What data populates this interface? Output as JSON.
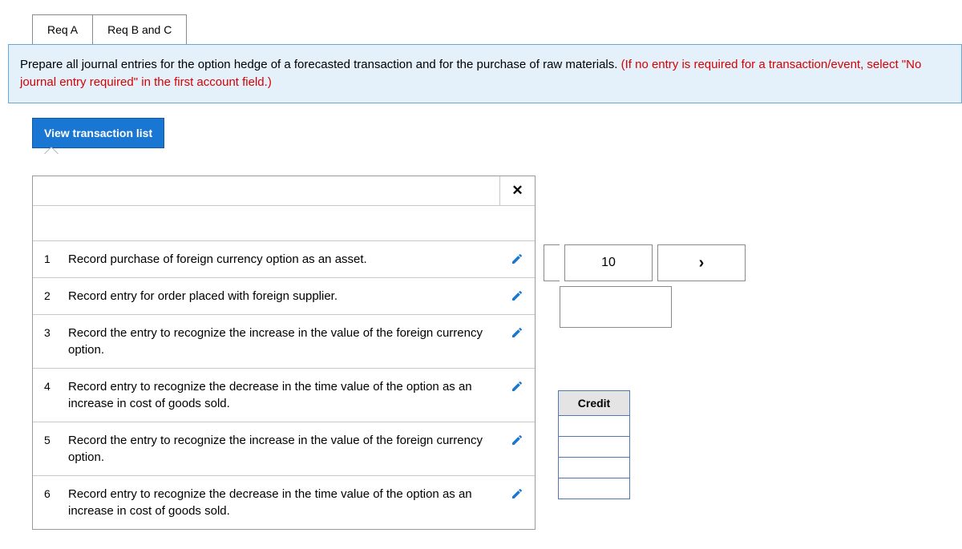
{
  "tabs": {
    "a": "Req A",
    "b": "Req B and C"
  },
  "instruction": {
    "main": "Prepare all journal entries for the option hedge of a forecasted transaction and for the purchase of raw materials. ",
    "red": "(If no entry is required for a transaction/event, select \"No journal entry required\" in the first account field.)"
  },
  "view_btn": "View transaction list",
  "close_label": "✕",
  "transactions": [
    {
      "n": "1",
      "text": "Record purchase of foreign currency option as an asset."
    },
    {
      "n": "2",
      "text": "Record entry for order placed with foreign supplier."
    },
    {
      "n": "3",
      "text": "Record the entry to recognize the increase in the value of the foreign currency option."
    },
    {
      "n": "4",
      "text": "Record entry to recognize the decrease in the time value of the option as an increase in cost of goods sold."
    },
    {
      "n": "5",
      "text": "Record the entry to recognize the increase in the value of the foreign currency option."
    },
    {
      "n": "6",
      "text": "Record entry to recognize the decrease in the time value of the option as an increase in cost of goods sold."
    }
  ],
  "pager": {
    "current": "10"
  },
  "table": {
    "credit_header": "Credit"
  }
}
